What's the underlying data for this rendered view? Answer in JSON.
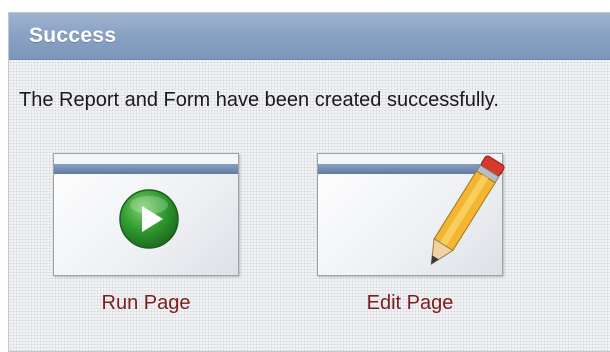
{
  "region": {
    "title": "Success",
    "message": "The Report and Form have been created successfully."
  },
  "actions": [
    {
      "label": "Run Page",
      "icon": "play-icon"
    },
    {
      "label": "Edit Page",
      "icon": "pencil-icon"
    }
  ],
  "colors": {
    "header": "#8aa2c4",
    "link": "#7a1d1d",
    "play_green": "#2e9a2e"
  }
}
